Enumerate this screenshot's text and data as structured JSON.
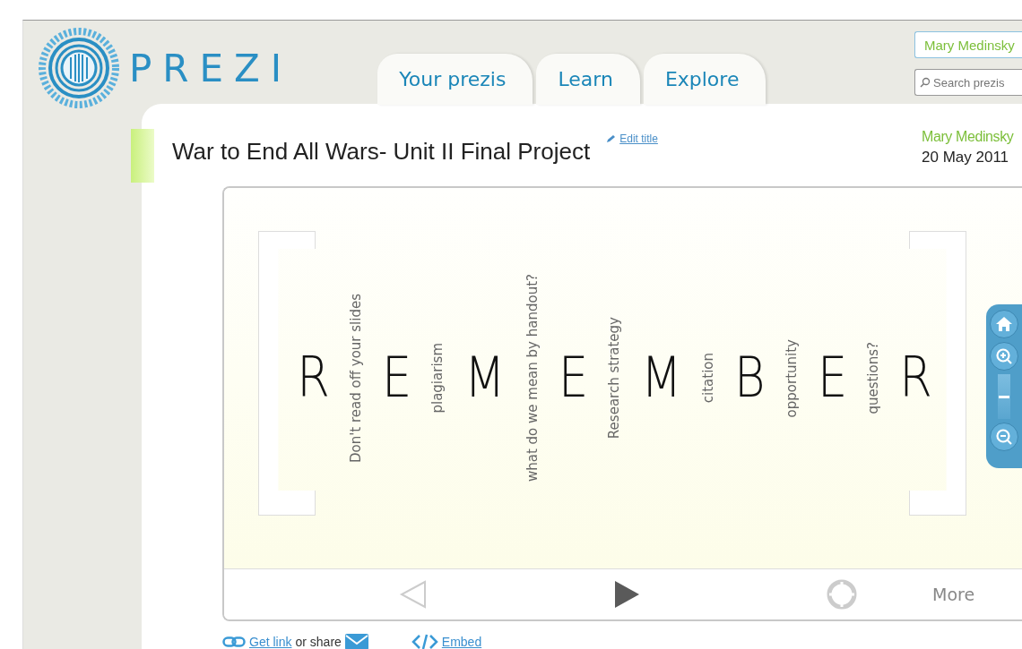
{
  "logo": {
    "text": "PREZI"
  },
  "tabs": [
    {
      "label": "Your prezis",
      "selected": false
    },
    {
      "label": "Learn",
      "selected": false
    },
    {
      "label": "Explore",
      "selected": false
    }
  ],
  "user_field": {
    "value": "Mary Medinsky"
  },
  "search": {
    "placeholder": "Search prezis"
  },
  "prezi": {
    "title": "War to End All Wars- Unit II Final Project",
    "edit_link": "Edit title",
    "author": "Mary Medinsky",
    "date": "20 May 2011"
  },
  "slide": {
    "items": [
      {
        "kind": "letter",
        "text": "R"
      },
      {
        "kind": "word",
        "text": "Don't read off your slides"
      },
      {
        "kind": "letter",
        "text": "E"
      },
      {
        "kind": "word",
        "text": "plagiarism"
      },
      {
        "kind": "letter",
        "text": "M"
      },
      {
        "kind": "word",
        "text": "what do we mean by handout?"
      },
      {
        "kind": "letter",
        "text": "E"
      },
      {
        "kind": "word",
        "text": "Research strategy"
      },
      {
        "kind": "letter",
        "text": "M"
      },
      {
        "kind": "word",
        "text": "citation"
      },
      {
        "kind": "letter",
        "text": "B"
      },
      {
        "kind": "word",
        "text": "opportunity"
      },
      {
        "kind": "letter",
        "text": "E"
      },
      {
        "kind": "word",
        "text": "questions?"
      },
      {
        "kind": "letter",
        "text": "R"
      }
    ]
  },
  "zoom": {
    "level": 0.5
  },
  "player": {
    "more": "More"
  },
  "share": {
    "get_link": "Get link",
    "or_share": "or share",
    "embed": "Embed"
  }
}
